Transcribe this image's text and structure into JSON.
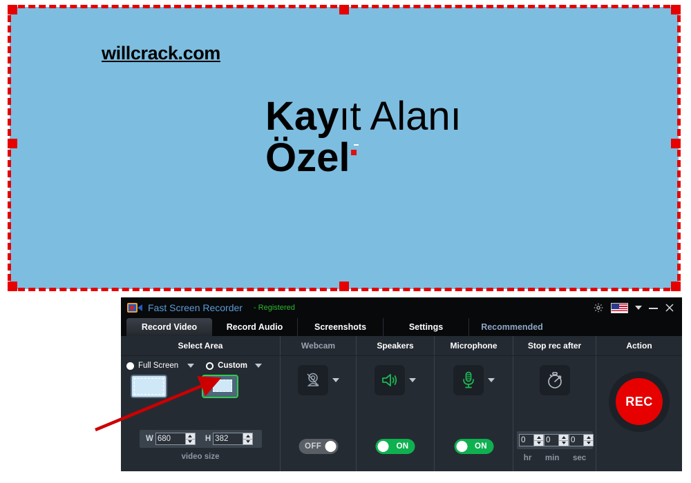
{
  "capture": {
    "watermark": "willcrack.com",
    "heading_bold": "Kay",
    "heading_regular": "ıt Alanı",
    "subheading": "Özel",
    "background_color": "#7dbde0",
    "border_color": "#e60000"
  },
  "window": {
    "title": "Fast Screen Recorder",
    "registration": "- Registered",
    "icon": "video-camera-icon",
    "titlebar_buttons": {
      "settings": "gear-icon",
      "language_flag": "us-flag-icon",
      "language_caret": "chevron-down-icon",
      "minimize": "minimize-icon",
      "close": "close-icon"
    }
  },
  "tabs": [
    {
      "label": "Record Video",
      "active": true
    },
    {
      "label": "Record Audio",
      "active": false
    },
    {
      "label": "Screenshots",
      "active": false
    },
    {
      "label": "Settings",
      "active": false
    },
    {
      "label": "Recommended",
      "active": false,
      "muted": true
    }
  ],
  "sections": {
    "select_area": {
      "header": "Select Area",
      "full_screen": {
        "label": "Full Screen",
        "selected": true
      },
      "custom": {
        "label": "Custom",
        "selected": false,
        "highlighted": true
      },
      "width_label": "W",
      "width_value": "680",
      "height_label": "H",
      "height_value": "382",
      "caption": "video size"
    },
    "webcam": {
      "header": "Webcam",
      "icon": "webcam-disabled-icon",
      "toggle_label": "OFF",
      "enabled": false
    },
    "speakers": {
      "header": "Speakers",
      "icon": "speaker-icon",
      "toggle_label": "ON",
      "enabled": true
    },
    "microphone": {
      "header": "Microphone",
      "icon": "microphone-icon",
      "toggle_label": "ON",
      "enabled": true
    },
    "stop_rec_after": {
      "header": "Stop rec after",
      "icon": "stopwatch-icon",
      "hours_value": "0",
      "minutes_value": "0",
      "seconds_value": "0",
      "hours_label": "hr",
      "minutes_label": "min",
      "seconds_label": "sec"
    },
    "action": {
      "header": "Action",
      "rec_label": "REC",
      "rec_color": "#e60000"
    }
  }
}
